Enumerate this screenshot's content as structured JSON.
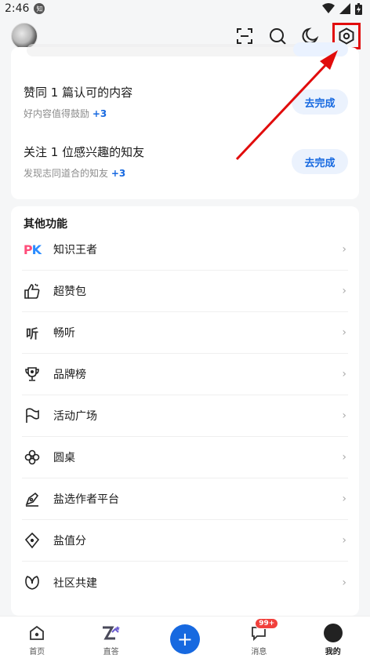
{
  "status": {
    "time": "2:46",
    "app_badge": "知"
  },
  "tasks": [
    {
      "title": "赞同 1 篇认可的内容",
      "subtitle": "好内容值得鼓励",
      "bonus": "+3",
      "button": "去完成"
    },
    {
      "title": "关注 1 位感兴趣的知友",
      "subtitle": "发现志同道合的知友",
      "bonus": "+3",
      "button": "去完成"
    }
  ],
  "features": {
    "title": "其他功能",
    "items": [
      {
        "label": "知识王者",
        "icon": "pk-icon"
      },
      {
        "label": "超赞包",
        "icon": "thumbs-up-icon"
      },
      {
        "label": "畅听",
        "icon": "ting-icon"
      },
      {
        "label": "品牌榜",
        "icon": "trophy-icon"
      },
      {
        "label": "活动广场",
        "icon": "flag-icon"
      },
      {
        "label": "圆桌",
        "icon": "flower-icon"
      },
      {
        "label": "盐选作者平台",
        "icon": "pen-icon"
      },
      {
        "label": "盐值分",
        "icon": "diamond-icon"
      },
      {
        "label": "社区共建",
        "icon": "leaf-icon"
      }
    ],
    "pk_p": "P",
    "pk_k": "K",
    "ting_glyph": "听"
  },
  "nav": {
    "home": "首页",
    "zhida": "直答",
    "messages": "消息",
    "messages_badge": "99+",
    "me": "我的"
  },
  "colors": {
    "accent": "#1769e0",
    "highlight": "#e10c0c"
  }
}
